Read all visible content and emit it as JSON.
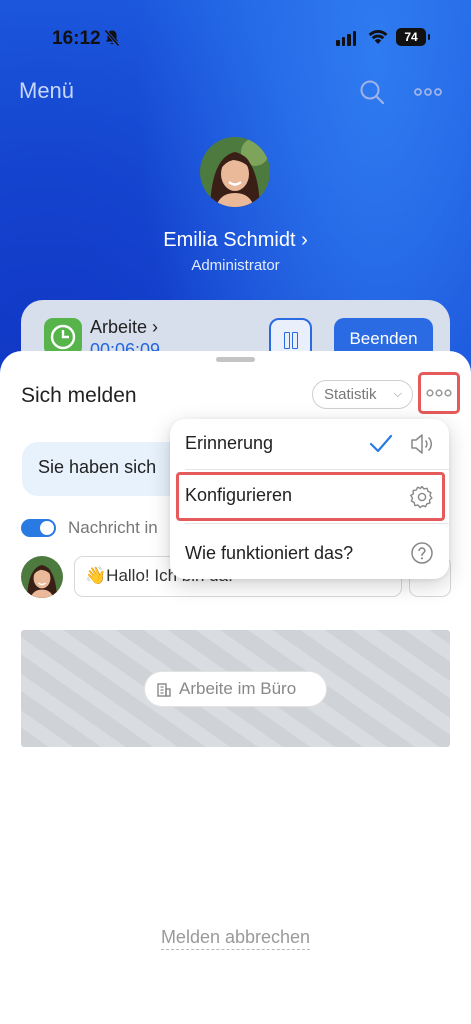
{
  "status_bar": {
    "time": "16:12",
    "battery": "74"
  },
  "header": {
    "title": "Menü"
  },
  "profile": {
    "name": "Emilia Schmidt ›",
    "role": "Administrator"
  },
  "work_card": {
    "title": "Arbeite ›",
    "elapsed": "00:06:09",
    "end_label": "Beenden"
  },
  "sheet": {
    "title": "Sich melden",
    "stat_label": "Statistik",
    "notice": "Sie haben sich",
    "toggle_label": "Nachricht in",
    "toggle_on": true,
    "message": "👋Hallo! Ich bin da.",
    "map_chip": "Arbeite im Büro",
    "cancel": "Melden abbrechen"
  },
  "popup_menu": {
    "items": [
      {
        "label": "Erinnerung",
        "icons": [
          "checkmark-icon",
          "speaker-icon"
        ]
      },
      {
        "label": "Konfigurieren",
        "icons": [
          "gear-icon"
        ],
        "highlighted": true
      },
      {
        "label": "Wie funktioniert das?",
        "icons": [
          "question-icon"
        ]
      }
    ]
  },
  "colors": {
    "accent": "#2a6be4",
    "highlight": "#e55a5a",
    "background": "#1a4fd6"
  }
}
